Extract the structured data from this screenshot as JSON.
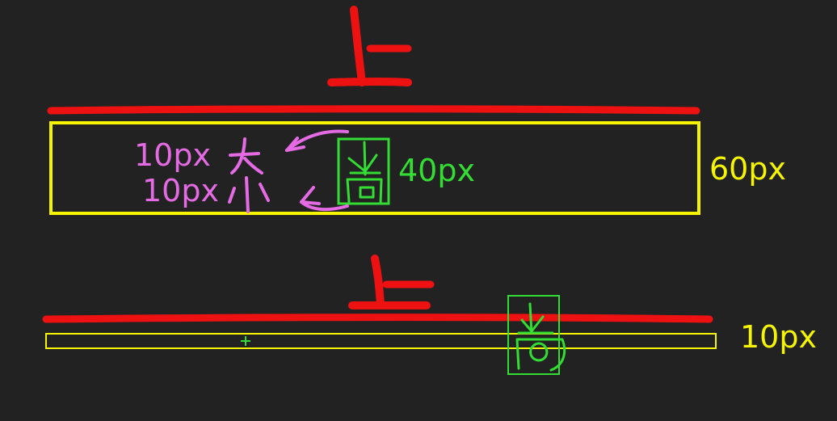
{
  "colors": {
    "background": "#222222",
    "red": "#ee1111",
    "yellow": "#f5f500",
    "green": "#33dd33",
    "pink": "#e56be5"
  },
  "top": {
    "height_label": "60px",
    "element_label": "40px",
    "half_label_upper": "10px",
    "half_label_lower": "10px"
  },
  "bottom": {
    "height_label": "10px"
  }
}
